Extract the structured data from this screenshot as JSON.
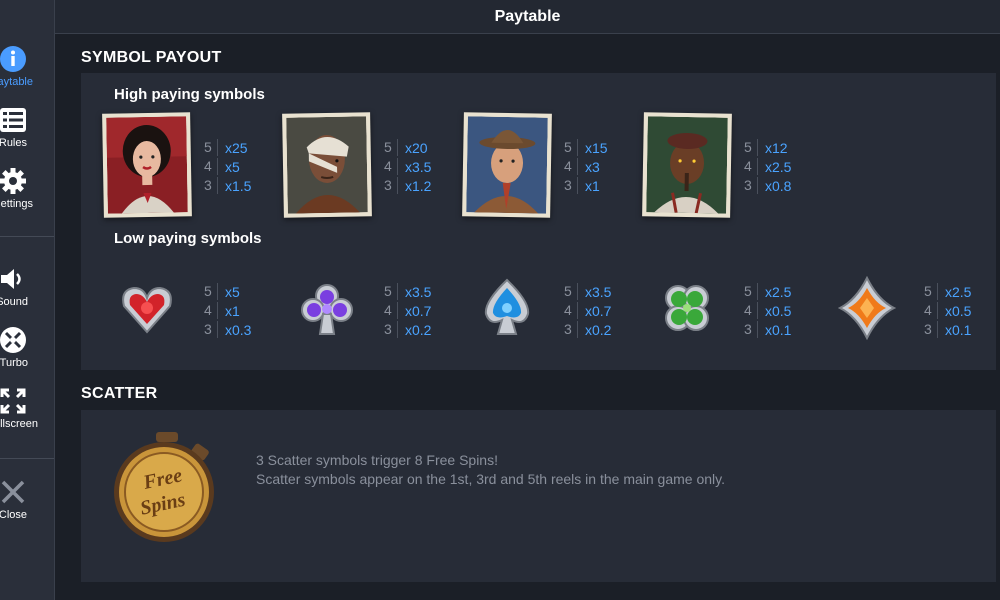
{
  "header": {
    "title": "Paytable"
  },
  "sidebar": {
    "items": [
      {
        "label": "Paytable",
        "icon": "info-icon",
        "active": true
      },
      {
        "label": "Rules",
        "icon": "list-icon"
      },
      {
        "label": "Settings",
        "icon": "gear-icon"
      },
      {
        "label": "Sound",
        "icon": "speaker-icon"
      },
      {
        "label": "Turbo",
        "icon": "turbo-icon"
      },
      {
        "label": "Fullscreen",
        "icon": "fullscreen-icon"
      },
      {
        "label": "Close",
        "icon": "close-icon"
      }
    ]
  },
  "symbol_payout": {
    "title": "SYMBOL PAYOUT",
    "high_title": "High paying symbols",
    "low_title": "Low paying symbols",
    "high": [
      {
        "name": "woman-portrait",
        "pays": [
          {
            "count": "5",
            "value": "x25"
          },
          {
            "count": "4",
            "value": "x5"
          },
          {
            "count": "3",
            "value": "x1.5"
          }
        ]
      },
      {
        "name": "bandaged-man-portrait",
        "pays": [
          {
            "count": "5",
            "value": "x20"
          },
          {
            "count": "4",
            "value": "x3.5"
          },
          {
            "count": "3",
            "value": "x1.2"
          }
        ]
      },
      {
        "name": "fedora-man-portrait",
        "pays": [
          {
            "count": "5",
            "value": "x15"
          },
          {
            "count": "4",
            "value": "x3"
          },
          {
            "count": "3",
            "value": "x1"
          }
        ]
      },
      {
        "name": "cigar-man-portrait",
        "pays": [
          {
            "count": "5",
            "value": "x12"
          },
          {
            "count": "4",
            "value": "x2.5"
          },
          {
            "count": "3",
            "value": "x0.8"
          }
        ]
      }
    ],
    "low": [
      {
        "name": "heart-symbol",
        "color": "#e0282e",
        "pays": [
          {
            "count": "5",
            "value": "x5"
          },
          {
            "count": "4",
            "value": "x1"
          },
          {
            "count": "3",
            "value": "x0.3"
          }
        ]
      },
      {
        "name": "club-symbol",
        "color": "#7b3fe0",
        "pays": [
          {
            "count": "5",
            "value": "x3.5"
          },
          {
            "count": "4",
            "value": "x0.7"
          },
          {
            "count": "3",
            "value": "x0.2"
          }
        ]
      },
      {
        "name": "spade-symbol",
        "color": "#1f8fe0",
        "pays": [
          {
            "count": "5",
            "value": "x3.5"
          },
          {
            "count": "4",
            "value": "x0.7"
          },
          {
            "count": "3",
            "value": "x0.2"
          }
        ]
      },
      {
        "name": "clover-symbol",
        "color": "#3aa83a",
        "pays": [
          {
            "count": "5",
            "value": "x2.5"
          },
          {
            "count": "4",
            "value": "x0.5"
          },
          {
            "count": "3",
            "value": "x0.1"
          }
        ]
      },
      {
        "name": "diamond-symbol",
        "color": "#f07a1a",
        "pays": [
          {
            "count": "5",
            "value": "x2.5"
          },
          {
            "count": "4",
            "value": "x0.5"
          },
          {
            "count": "3",
            "value": "x0.1"
          }
        ]
      }
    ]
  },
  "scatter": {
    "title": "SCATTER",
    "badge_text_1": "Free",
    "badge_text_2": "Spins",
    "line1": "3 Scatter symbols trigger 8 Free Spins!",
    "line2": "Scatter symbols appear on the 1st, 3rd and 5th reels in the main game only."
  },
  "colors": {
    "background": "#1b1f27",
    "panel": "#272c37",
    "accent": "#4aa3ff",
    "muted_text": "#8a909c"
  }
}
